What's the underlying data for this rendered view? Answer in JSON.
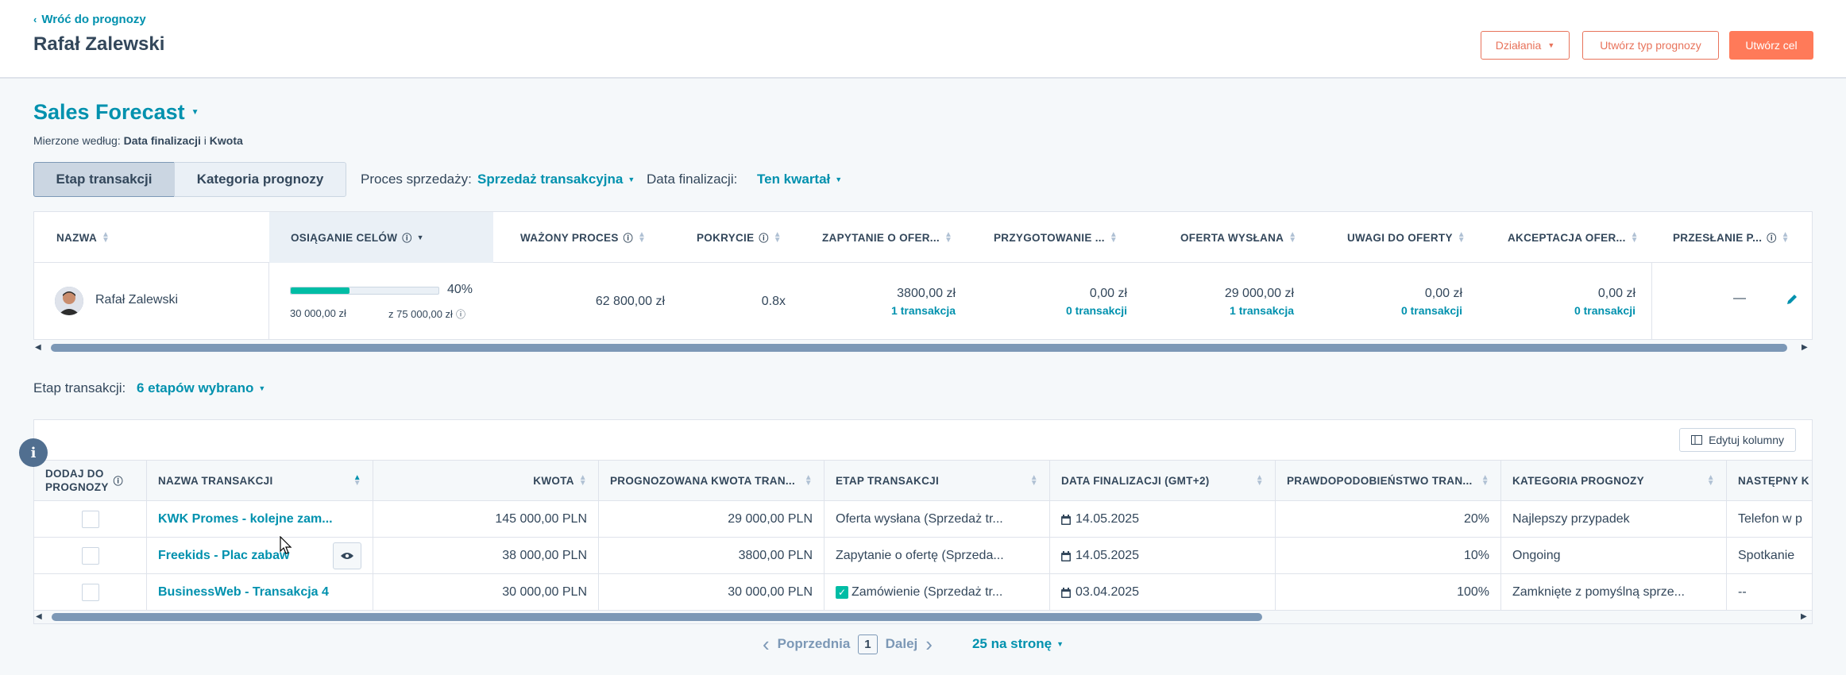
{
  "header": {
    "back_label": "Wróć do prognozy",
    "person_name": "Rafał Zalewski",
    "actions_label": "Działania",
    "create_type_label": "Utwórz typ prognozy",
    "create_goal_label": "Utwórz cel"
  },
  "forecast": {
    "title": "Sales Forecast",
    "measured_prefix": "Mierzone według:",
    "measured_a": "Data finalizacji",
    "measured_sep": "i",
    "measured_b": "Kwota",
    "tabs": [
      "Etap transakcji",
      "Kategoria prognozy"
    ],
    "pipeline_label": "Proces sprzedaży:",
    "pipeline_value": "Sprzedaż transakcyjna",
    "close_label": "Data finalizacji:",
    "close_value": "Ten kwartał"
  },
  "summary_table": {
    "headers": [
      "NAZWA",
      "OSIĄGANIE CELÓW",
      "WAŻONY PROCES",
      "POKRYCIE",
      "ZAPYTANIE O OFER...",
      "PRZYGOTOWANIE ...",
      "OFERTA WYSŁANA",
      "UWAGI DO OFERTY",
      "AKCEPTACJA OFER...",
      "PRZESŁANIE P..."
    ],
    "row": {
      "name": "Rafał Zalewski",
      "goal_percent": "40%",
      "goal_progress": 0.4,
      "goal_current": "30 000,00 zł",
      "goal_target": "z 75 000,00 zł",
      "weighted": "62 800,00 zł",
      "coverage": "0.8x",
      "stages": [
        {
          "amount": "3800,00 zł",
          "count": "1 transakcja"
        },
        {
          "amount": "0,00 zł",
          "count": "0 transakcji"
        },
        {
          "amount": "29 000,00 zł",
          "count": "1 transakcja"
        },
        {
          "amount": "0,00 zł",
          "count": "0 transakcji"
        },
        {
          "amount": "0,00 zł",
          "count": "0 transakcji"
        }
      ],
      "last": "—"
    }
  },
  "deals": {
    "stage_label": "Etap transakcji:",
    "stage_value": "6 etapów wybrano",
    "edit_columns": "Edytuj kolumny",
    "headers": {
      "add_line1": "DODAJ DO",
      "add_line2": "PROGNOZY",
      "name": "NAZWA TRANSAKCJI",
      "amount": "KWOTA",
      "forecast_amount": "PROGNOZOWANA KWOTA TRAN...",
      "stage": "ETAP TRANSAKCJI",
      "close_date": "DATA FINALIZACJI (GMT+2)",
      "probability": "PRAWDOPODOBIEŃSTWO TRAN...",
      "category": "KATEGORIA PROGNOZY",
      "next": "NASTĘPNY K"
    },
    "rows": [
      {
        "name": "KWK Promes - kolejne zam...",
        "amount": "145 000,00 PLN",
        "forecast": "29 000,00 PLN",
        "stage": "Oferta wysłana (Sprzedaż tr...",
        "date": "14.05.2025",
        "prob": "20%",
        "category": "Najlepszy przypadek",
        "next": "Telefon w p"
      },
      {
        "name": "Freekids - Plac zabaw",
        "amount": "38 000,00 PLN",
        "forecast": "3800,00 PLN",
        "stage": "Zapytanie o ofertę (Sprzeda...",
        "date": "14.05.2025",
        "prob": "10%",
        "category": "Ongoing",
        "next": "Spotkanie"
      },
      {
        "name": "BusinessWeb - Transakcja 4",
        "amount": "30 000,00 PLN",
        "forecast": "30 000,00 PLN",
        "stage": "Zamówienie (Sprzedaż tr...",
        "date": "03.04.2025",
        "prob": "100%",
        "category": "Zamknięte z pomyślną sprze...",
        "next": "--"
      }
    ]
  },
  "pagination": {
    "prev": "Poprzednia",
    "page": "1",
    "next": "Dalej",
    "per_page": "25 na stronę"
  },
  "info_badge": "i",
  "colors": {
    "accent": "#0091ae",
    "orange": "#ff7a59",
    "progress": "#00bda5",
    "text": "#33475b"
  }
}
